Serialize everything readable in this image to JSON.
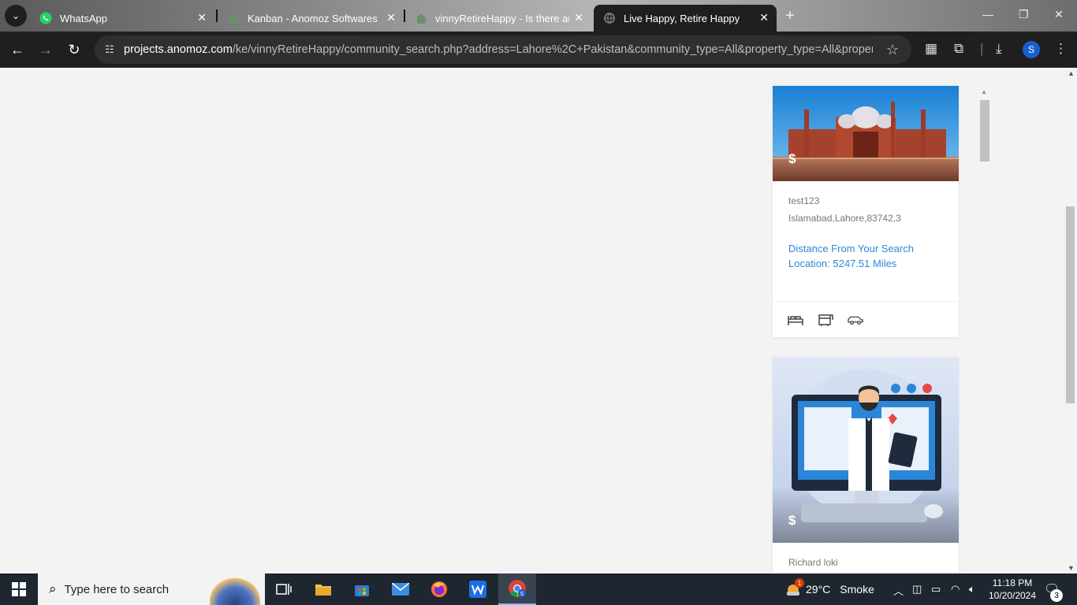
{
  "browser": {
    "tabs": [
      {
        "title": "WhatsApp",
        "icon": "whatsapp-icon",
        "active": false
      },
      {
        "title": "Kanban - Anomoz Softwares",
        "icon": "puzzle-icon",
        "active": false
      },
      {
        "title": "vinnyRetireHappy - Is there an",
        "icon": "puzzle-icon",
        "active": false
      },
      {
        "title": "Live Happy, Retire Happy",
        "icon": "globe-icon",
        "active": true
      }
    ],
    "url_host": "projects.anomoz.com",
    "url_path": "/ke/vinnyRetireHappy/community_search.php?address=Lahore%2C+Pakistan&community_type=All&property_type=All&property_...",
    "profile_initial": "S"
  },
  "cards": [
    {
      "price_symbol": "$",
      "name": "test123",
      "address": "Islamabad,Lahore,83742,3",
      "distance": "Distance From Your Search Location: 5247.51 Miles",
      "features": [
        "bed-icon",
        "bath-icon",
        "car-icon"
      ]
    },
    {
      "price_symbol": "$",
      "name": "Richard loki"
    }
  ],
  "taskbar": {
    "search_placeholder": "Type here to search",
    "weather_temp": "29°C",
    "weather_desc": "Smoke",
    "weather_alert": "1",
    "time": "11:18 PM",
    "date": "10/20/2024",
    "notification_count": "3"
  },
  "colors": {
    "link": "#2f86d6",
    "browser_dark": "#1f1f1f",
    "taskbar": "#1e2630"
  }
}
